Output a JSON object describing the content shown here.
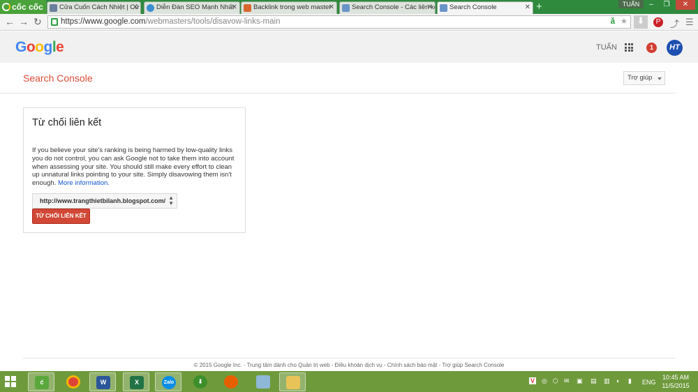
{
  "browser": {
    "brand": "cốc cốc",
    "tabs": [
      {
        "label": "Cửa Cuốn Cách Nhiệt | Cử",
        "active": false
      },
      {
        "label": "Diễn Đàn SEO Mạnh Nhất",
        "active": false
      },
      {
        "label": "Backlink trong web master",
        "active": false
      },
      {
        "label": "Search Console - Các liên kết",
        "active": false
      },
      {
        "label": "Search Console",
        "active": true
      }
    ],
    "new_tab": "+",
    "window_user": "TUẤN",
    "url_host": "https://www.google.com",
    "url_path": "/webmasters/tools/disavow-links-main"
  },
  "google_bar": {
    "logo": [
      "G",
      "o",
      "o",
      "g",
      "l",
      "e"
    ],
    "user": "TUẤN",
    "notifications": "1",
    "avatar": "HT"
  },
  "console": {
    "title": "Search Console",
    "help_label": "Trợ giúp"
  },
  "card": {
    "heading": "Từ chối liên kết",
    "body": "If you believe your site's ranking is being harmed by low-quality links you do not control, you can ask Google not to take them into account when assessing your site. You should still make every effort to clean up unnatural links pointing to your site. Simply disavowing them isn't enough.",
    "more_link": "More information.",
    "site_select": "http://www.trangthietbilanh.blogspot.com/",
    "button_label": "TỪ CHỐI LIÊN KẾT"
  },
  "footer": {
    "copyright": "© 2015 Google Inc.",
    "links": [
      "Trung tâm dành cho Quản trị web",
      "Điều khoản dịch vụ",
      "Chính sách bảo mật",
      "Trợ giúp Search Console"
    ],
    "separator": " - "
  },
  "taskbar": {
    "apps": [
      "coccoc",
      "chrome",
      "word",
      "excel",
      "zalo",
      "idm",
      "firefox",
      "app",
      "folder"
    ],
    "zalo_label": "Zalo",
    "language": "ENG",
    "time": "10:45 AM",
    "date": "11/5/2015"
  }
}
